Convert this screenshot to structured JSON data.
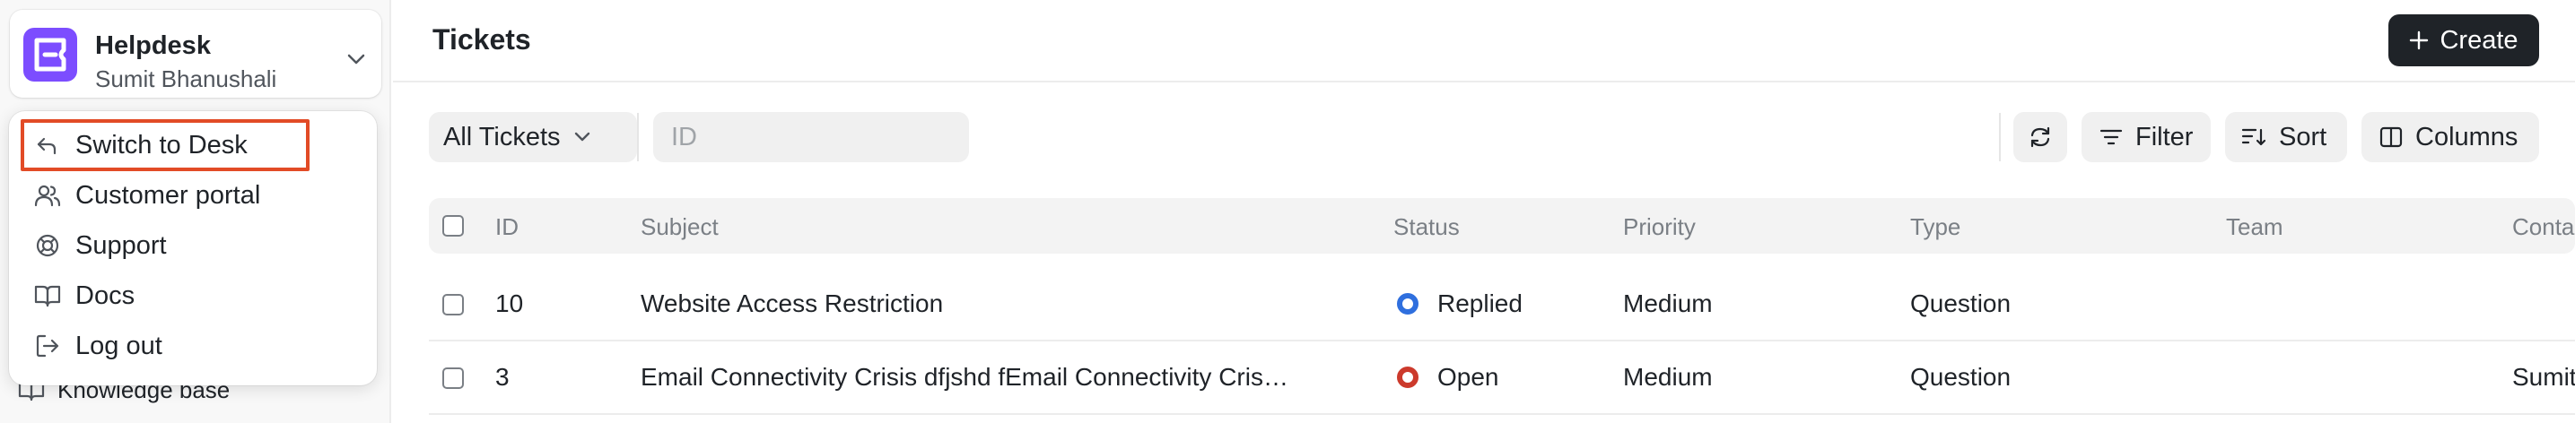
{
  "brand": {
    "title": "Helpdesk",
    "user": "Sumit Bhanushali"
  },
  "menu": {
    "items": [
      {
        "label": "Switch to Desk",
        "icon": "undo-arrow-icon"
      },
      {
        "label": "Customer portal",
        "icon": "users-icon"
      },
      {
        "label": "Support",
        "icon": "life-buoy-icon"
      },
      {
        "label": "Docs",
        "icon": "book-icon"
      },
      {
        "label": "Log out",
        "icon": "log-out-icon"
      }
    ]
  },
  "sidebar": {
    "knowledge_base": "Knowledge base"
  },
  "header": {
    "title": "Tickets",
    "create_label": "Create"
  },
  "toolbar": {
    "view_select": "All Tickets",
    "id_placeholder": "ID",
    "filter": "Filter",
    "sort": "Sort",
    "columns": "Columns"
  },
  "table": {
    "columns": [
      "ID",
      "Subject",
      "Status",
      "Priority",
      "Type",
      "Team",
      "Contact"
    ],
    "rows": [
      {
        "id": "10",
        "subject": "Website Access Restriction",
        "status": "Replied",
        "status_color": "#2f6fde",
        "priority": "Medium",
        "type": "Question",
        "team": "",
        "contact": ""
      },
      {
        "id": "3",
        "subject": "Email Connectivity Crisis dfjshd fEmail Connectivity Cris…",
        "status": "Open",
        "status_color": "#cc3a2c",
        "priority": "Medium",
        "type": "Question",
        "team": "",
        "contact": "Sumit Bh"
      }
    ]
  },
  "colors": {
    "brand": "#7c4dff",
    "highlight": "#e24b26",
    "primary_button": "#1f2328"
  }
}
